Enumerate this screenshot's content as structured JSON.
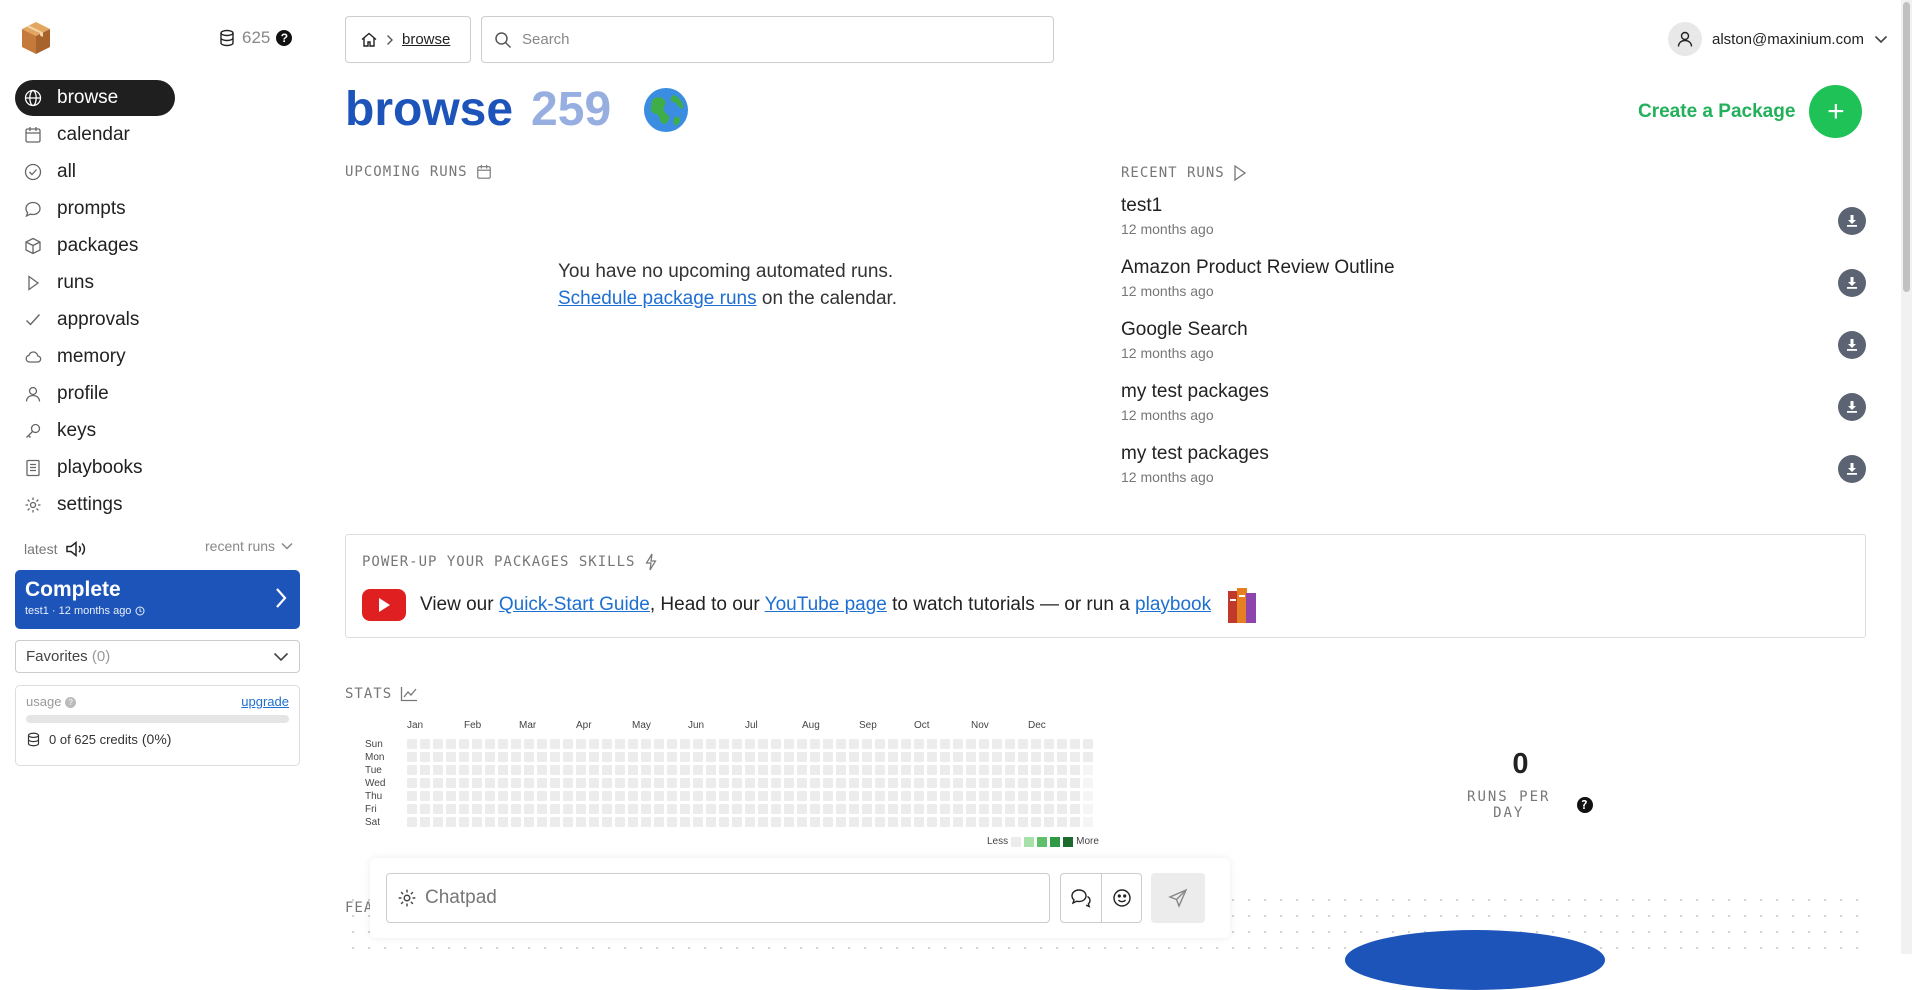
{
  "sidebar": {
    "credits": "625",
    "help": "?",
    "items": [
      {
        "label": "browse",
        "icon": "globe-icon"
      },
      {
        "label": "calendar",
        "icon": "calendar-icon"
      },
      {
        "label": "all",
        "icon": "check-circle-icon"
      },
      {
        "label": "prompts",
        "icon": "chat-icon"
      },
      {
        "label": "packages",
        "icon": "box-icon"
      },
      {
        "label": "runs",
        "icon": "play-icon"
      },
      {
        "label": "approvals",
        "icon": "check-icon"
      },
      {
        "label": "memory",
        "icon": "cloud-icon"
      },
      {
        "label": "profile",
        "icon": "user-icon"
      },
      {
        "label": "keys",
        "icon": "key-icon"
      },
      {
        "label": "playbooks",
        "icon": "book-icon"
      },
      {
        "label": "settings",
        "icon": "gear-icon"
      }
    ],
    "latest": "latest",
    "recent_runs": "recent runs",
    "status": {
      "title": "Complete",
      "run": "test1",
      "sep": "·",
      "time": "12 months ago"
    },
    "favorites": {
      "label": "Favorites",
      "count": "(0)"
    },
    "usage": {
      "label": "usage",
      "upgrade": "upgrade",
      "credits_text": "0 of 625 credits",
      "percent": "(0%)",
      "fraction": 0
    }
  },
  "header": {
    "breadcrumb": "browse",
    "search_placeholder": "Search",
    "user_email": "alston@maxinium.com"
  },
  "page": {
    "title": "browse",
    "count": "259",
    "create_label": "Create a Package",
    "upcoming_label": "UPCOMING RUNS",
    "empty_line1": "You have no upcoming automated runs.",
    "empty_link": "Schedule package runs",
    "empty_rest": " on the calendar.",
    "recent_label": "RECENT RUNS",
    "recent_runs": [
      {
        "name": "test1",
        "time": "12 months ago"
      },
      {
        "name": "Amazon Product Review Outline",
        "time": "12 months ago"
      },
      {
        "name": "Google Search",
        "time": "12 months ago"
      },
      {
        "name": "my test packages",
        "time": "12 months ago"
      },
      {
        "name": "my test packages",
        "time": "12 months ago"
      }
    ],
    "power": {
      "label": "POWER-UP YOUR PACKAGES SKILLS",
      "t1": "View our ",
      "quick": "Quick-Start Guide",
      "t2": ", Head to our ",
      "yt": "YouTube page",
      "t3": " to watch tutorials — or run a ",
      "playbook": "playbook"
    },
    "stats_label": "STATS",
    "months": [
      "Jan",
      "Feb",
      "Mar",
      "Apr",
      "May",
      "Jun",
      "Jul",
      "Aug",
      "Sep",
      "Oct",
      "Nov",
      "Dec"
    ],
    "days": [
      "Sun",
      "Mon",
      "Tue",
      "Wed",
      "Thu",
      "Fri",
      "Sat"
    ],
    "legend_less": "Less",
    "legend_more": "More",
    "runs_per_day_value": "0",
    "runs_per_day_label": "RUNS PER DAY",
    "features_label": "FEA",
    "chat_placeholder": "Chatpad"
  },
  "colors": {
    "accent": "#1d54b9",
    "green": "#1ec256",
    "link": "#1d6fd1"
  }
}
